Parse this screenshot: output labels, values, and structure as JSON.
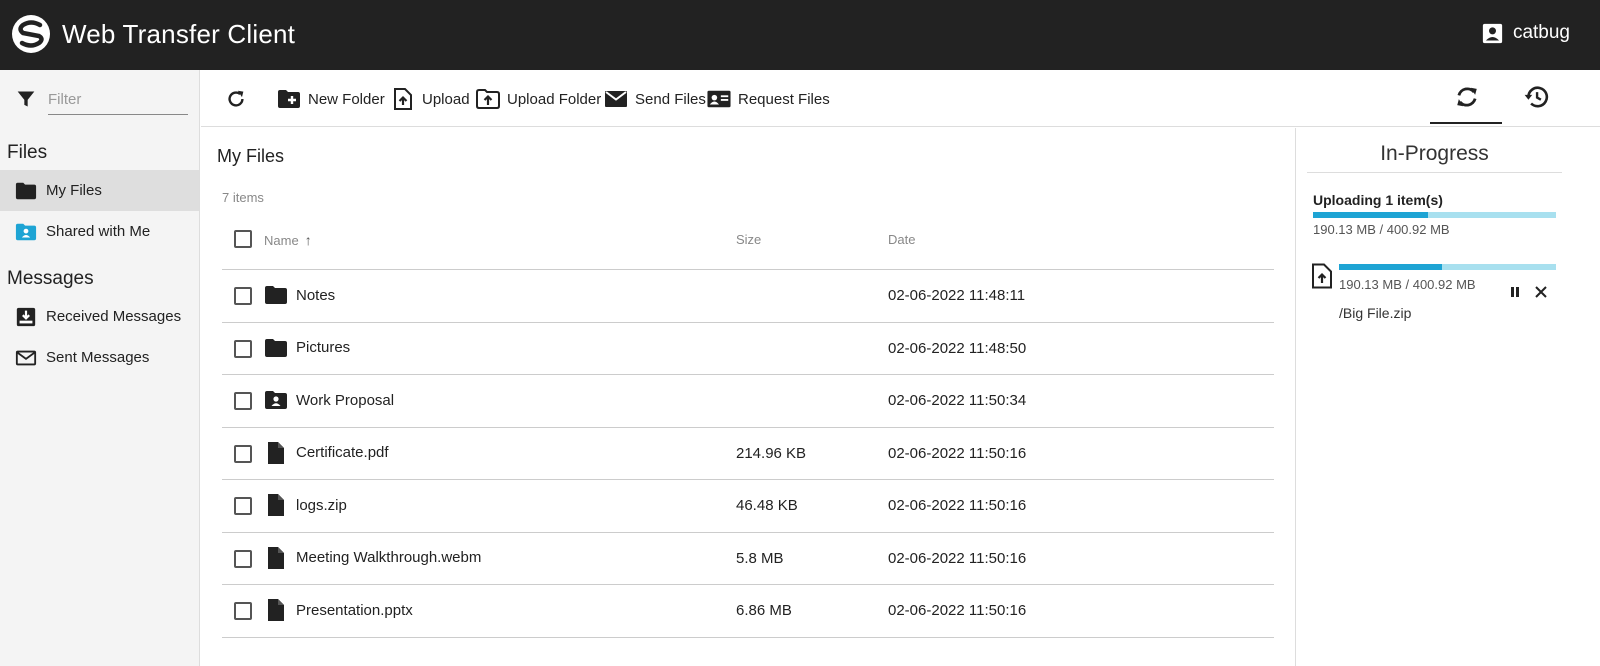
{
  "app": {
    "title": "Web Transfer Client",
    "logo": "logo-icon"
  },
  "user": {
    "name": "catbug",
    "icon": "user-icon"
  },
  "sidebar": {
    "filter_placeholder": "Filter",
    "files_heading": "Files",
    "files_items": [
      {
        "label": "My Files",
        "icon": "folder-icon",
        "active": true
      },
      {
        "label": "Shared with Me",
        "icon": "shared-folder-icon",
        "active": false
      }
    ],
    "messages_heading": "Messages",
    "messages_items": [
      {
        "label": "Received Messages",
        "icon": "inbox-icon"
      },
      {
        "label": "Sent Messages",
        "icon": "envelope-icon"
      }
    ]
  },
  "toolbar": {
    "refresh_icon": "refresh-icon",
    "new_folder": "New Folder",
    "upload": "Upload",
    "upload_folder": "Upload Folder",
    "send_files": "Send Files",
    "request_files": "Request Files",
    "tabs": [
      {
        "icon": "sync-icon",
        "active": true
      },
      {
        "icon": "history-icon",
        "active": false
      }
    ]
  },
  "main": {
    "title": "My Files",
    "count": "7 items",
    "columns": {
      "name": "Name",
      "size": "Size",
      "date": "Date"
    },
    "rows": [
      {
        "name": "Notes",
        "type": "folder",
        "size": "",
        "date": "02-06-2022 11:48:11"
      },
      {
        "name": "Pictures",
        "type": "folder",
        "size": "",
        "date": "02-06-2022 11:48:50"
      },
      {
        "name": "Work Proposal",
        "type": "shared-folder",
        "size": "",
        "date": "02-06-2022 11:50:34"
      },
      {
        "name": "Certificate.pdf",
        "type": "file",
        "size": "214.96 KB",
        "date": "02-06-2022 11:50:16"
      },
      {
        "name": "logs.zip",
        "type": "file",
        "size": "46.48 KB",
        "date": "02-06-2022 11:50:16"
      },
      {
        "name": "Meeting Walkthrough.webm",
        "type": "file",
        "size": "5.8 MB",
        "date": "02-06-2022 11:50:16"
      },
      {
        "name": "Presentation.pptx",
        "type": "file",
        "size": "6.86 MB",
        "date": "02-06-2022 11:50:16"
      }
    ]
  },
  "panel": {
    "title": "In-Progress",
    "upload_label": "Uploading 1 item(s)",
    "upload_size": "190.13 MB / 400.92 MB",
    "upload_progress": 0.474,
    "item": {
      "size": "190.13 MB / 400.92 MB",
      "name": "/Big File.zip",
      "progress": 0.474
    }
  },
  "colors": {
    "topbar": "#222222",
    "progress_fill": "#1ea4d4",
    "progress_track": "#a8e0ef",
    "shared_icon": "#1ea4d4"
  }
}
